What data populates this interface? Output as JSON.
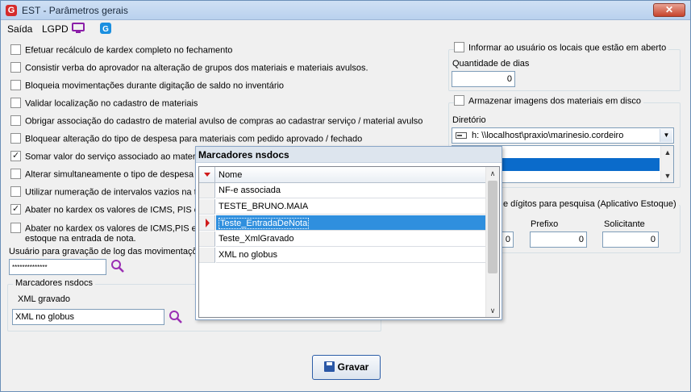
{
  "window": {
    "title": "EST - Parâmetros gerais",
    "close": "✕"
  },
  "menu": {
    "items": [
      "Saída",
      "LGPD"
    ]
  },
  "options": [
    {
      "label": "Efetuar recálculo de kardex completo no fechamento",
      "checked": false
    },
    {
      "label": "Consistir verba do aprovador na alteração de grupos dos materiais e materiais avulsos.",
      "checked": false
    },
    {
      "label": "Bloqueia movimentações durante digitação de saldo no inventário",
      "checked": false
    },
    {
      "label": "Validar localização no cadastro de materiais",
      "checked": false
    },
    {
      "label": "Obrigar associação do cadastro de material avulso de compras ao cadastrar serviço / material avulso",
      "checked": false
    },
    {
      "label": "Bloquear alteração do tipo de despesa para materiais com pedido aprovado / fechado",
      "checked": false
    },
    {
      "label": "Somar valor do serviço associado ao materia",
      "checked": true
    },
    {
      "label": "Alterar simultaneamente o tipo de despesa d",
      "checked": false
    },
    {
      "label": "Utilizar numeração de intervalos vazios na tr",
      "checked": false
    },
    {
      "label": "Abater no kardex os valores de ICMS, PIS e",
      "checked": true
    },
    {
      "label": "Abater no kardex os valores de ICMS,PIS e",
      "label2": "estoque na entrada de nota.",
      "checked": false
    }
  ],
  "log_user": {
    "label": "Usuário para gravação de log das movimentaçõe",
    "value": "**************"
  },
  "marcadores": {
    "group_title": "Marcadores nsdocs",
    "xml_label": "XML gravado",
    "xml_value": "XML no globus"
  },
  "right_panel": {
    "informar": {
      "label": "Informar ao usuário os locais que estão em aberto",
      "checked": false,
      "dias_label": "Quantidade de dias",
      "dias_value": "0"
    },
    "imagens": {
      "label": "Armazenar imagens dos materiais em disco",
      "checked": false,
      "dir_label": "Diretório",
      "dir_value": "h: \\\\localhost\\praxio\\marinesio.cordeiro"
    },
    "digitos": {
      "title": "e dígitos para pesquisa (Aplicativo Estoque)",
      "col1_value": "0",
      "prefixo_label": "Prefixo",
      "prefixo_value": "0",
      "solicitante_label": "Solicitante",
      "solicitante_value": "0"
    }
  },
  "popup": {
    "title": "Marcadores nsdocs",
    "column": "Nome",
    "rows": [
      "NF-e associada",
      "TESTE_BRUNO.MAIA",
      "Teste_EntradaDeNota",
      "Teste_XmlGravado",
      "XML no globus"
    ],
    "selected_index": 2
  },
  "buttons": {
    "gravar": "Gravar"
  },
  "colors": {
    "accent": "#0a6bcb",
    "selection": "#2f8fde",
    "brand": "#d52b2b"
  }
}
